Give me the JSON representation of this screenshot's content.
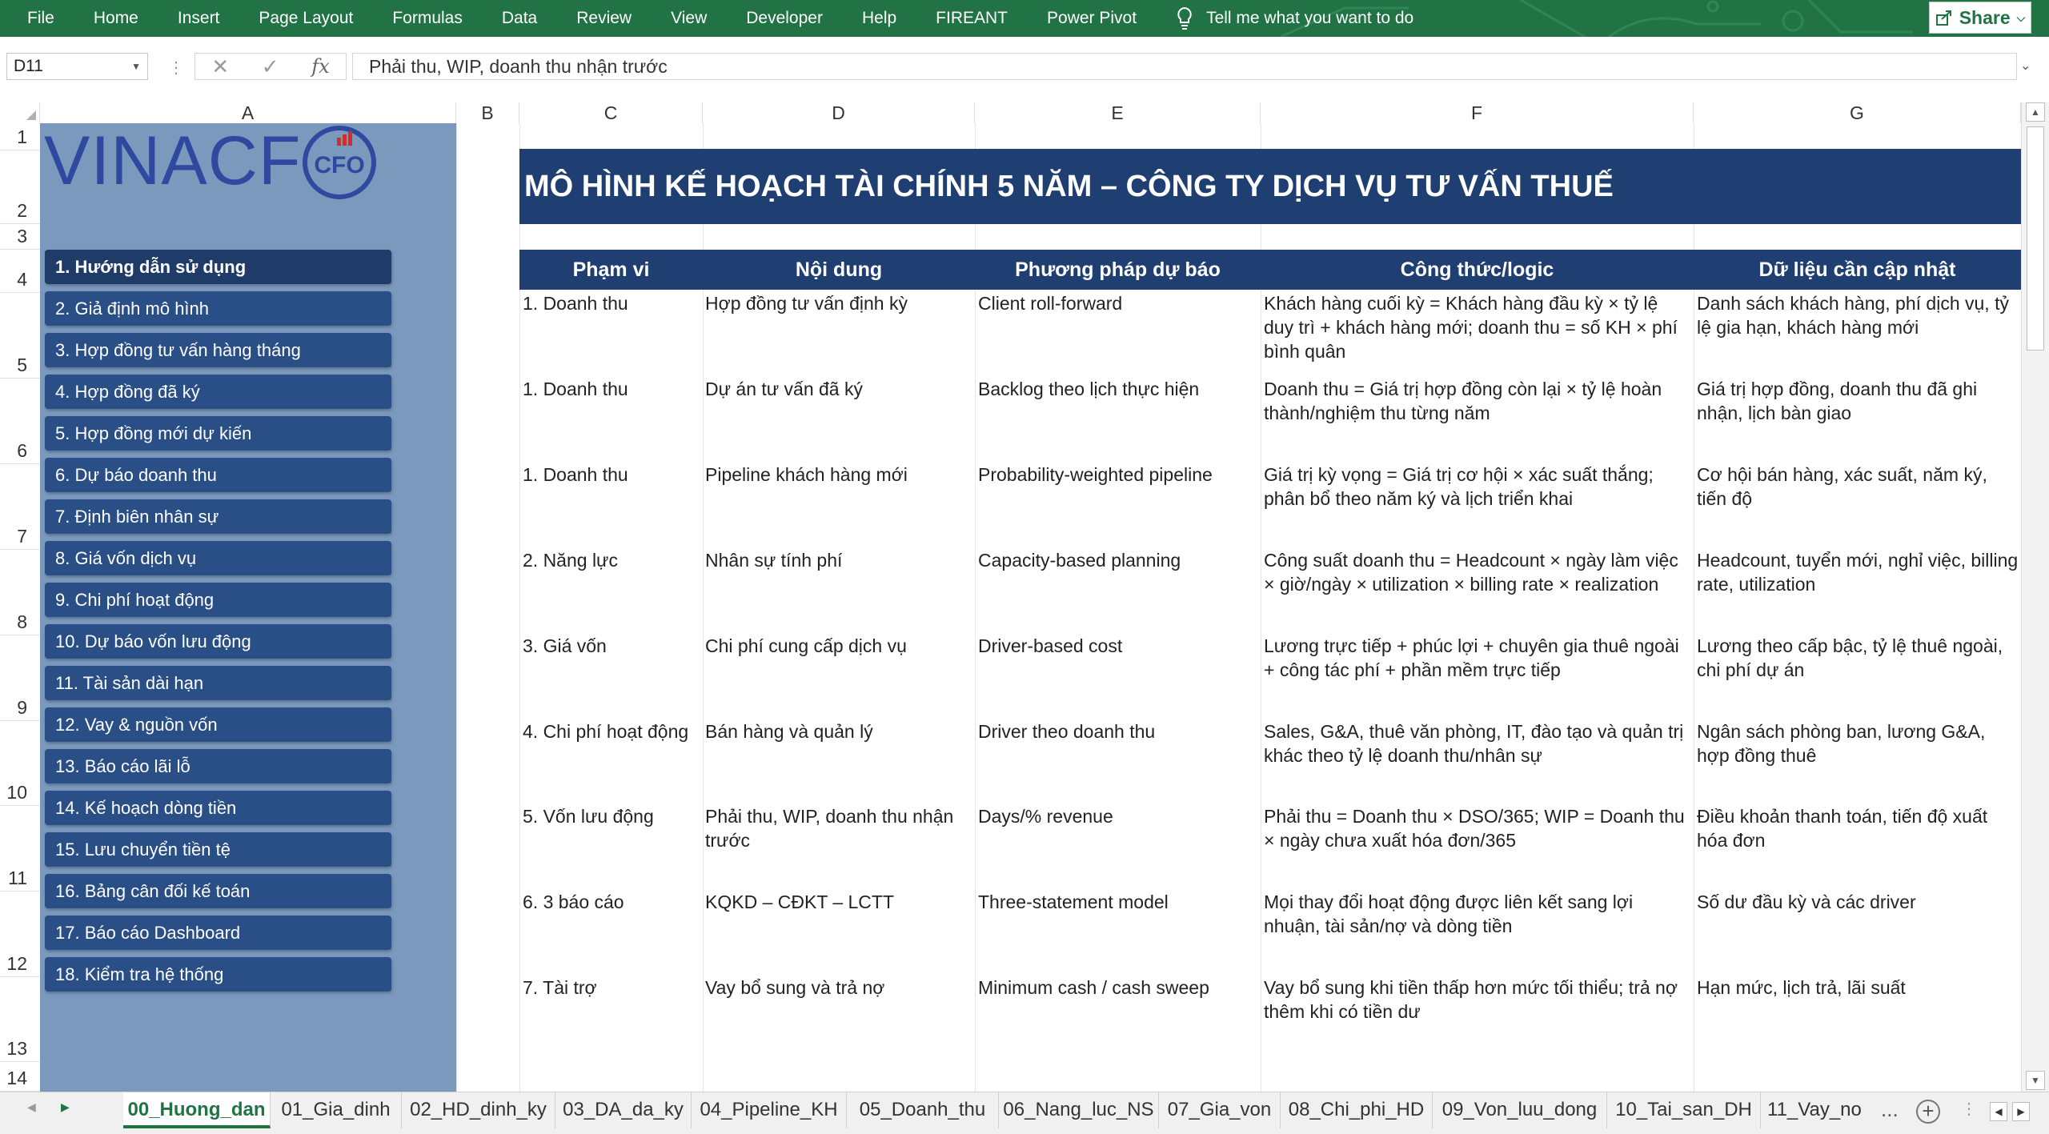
{
  "ribbon": {
    "menu": [
      "File",
      "Home",
      "Insert",
      "Page Layout",
      "Formulas",
      "Data",
      "Review",
      "View",
      "Developer",
      "Help",
      "FIREANT",
      "Power Pivot"
    ],
    "tell_me": "Tell me what you want to do",
    "share": "Share"
  },
  "formula_bar": {
    "name_box": "D11",
    "fx": "fx",
    "value": "Phải thu, WIP, doanh thu nhận trước"
  },
  "columns": [
    "A",
    "B",
    "C",
    "D",
    "E",
    "F",
    "G"
  ],
  "rows": [
    "1",
    "2",
    "3",
    "4",
    "5",
    "6",
    "7",
    "8",
    "9",
    "10",
    "11",
    "12",
    "13",
    "14"
  ],
  "logo": {
    "text": "VINACF",
    "badge": "CFO"
  },
  "nav": [
    "1. Hướng dẫn sử dụng",
    "2. Giả định mô hình",
    "3. Hợp đồng tư vấn hàng tháng",
    "4. Hợp đồng đã ký",
    "5. Hợp đồng mới dự kiến",
    "6. Dự báo doanh thu",
    "7. Định biên nhân sự",
    "8. Giá vốn dịch vụ",
    "9. Chi phí hoạt động",
    "10. Dự báo vốn lưu động",
    "11. Tài sản dài hạn",
    "12. Vay & nguồn vốn",
    "13. Báo cáo lãi lỗ",
    "14. Kế hoạch dòng tiền",
    "15. Lưu chuyển tiền tệ",
    "16. Bảng cân đối kế toán",
    "17. Báo cáo Dashboard",
    "18. Kiểm tra hệ thống"
  ],
  "title": "MÔ HÌNH KẾ HOẠCH TÀI CHÍNH 5 NĂM – CÔNG TY DỊCH VỤ TƯ VẤN THUẾ",
  "table": {
    "headers": [
      "Phạm vi",
      "Nội dung",
      "Phương pháp dự báo",
      "Công thức/logic",
      "Dữ liệu cần cập nhật"
    ],
    "rows": [
      [
        "1. Doanh thu",
        "Hợp đồng tư vấn định kỳ",
        "Client roll-forward",
        "Khách hàng cuối kỳ = Khách hàng đầu kỳ × tỷ lệ duy trì + khách hàng mới; doanh thu = số KH × phí bình quân",
        "Danh sách khách hàng, phí dịch vụ, tỷ lệ gia hạn, khách hàng mới"
      ],
      [
        "1. Doanh thu",
        "Dự án tư vấn đã ký",
        "Backlog theo lịch thực hiện",
        "Doanh thu = Giá trị hợp đồng còn lại × tỷ lệ hoàn thành/nghiệm thu từng năm",
        "Giá trị hợp đồng, doanh thu đã ghi nhận, lịch bàn giao"
      ],
      [
        "1. Doanh thu",
        "Pipeline khách hàng mới",
        "Probability-weighted pipeline",
        "Giá trị kỳ vọng = Giá trị cơ hội × xác suất thắng; phân bổ theo năm ký và lịch triển khai",
        "Cơ hội bán hàng, xác suất, năm ký, tiến độ"
      ],
      [
        "2. Năng lực",
        "Nhân sự tính phí",
        "Capacity-based planning",
        "Công suất doanh thu = Headcount × ngày làm việc × giờ/ngày × utilization × billing rate × realization",
        "Headcount, tuyển mới, nghỉ việc, billing rate, utilization"
      ],
      [
        "3. Giá vốn",
        "Chi phí cung cấp dịch vụ",
        "Driver-based cost",
        "Lương trực tiếp + phúc lợi + chuyên gia thuê ngoài + công tác phí + phần mềm trực tiếp",
        "Lương theo cấp bậc, tỷ lệ thuê ngoài, chi phí dự án"
      ],
      [
        "4. Chi phí hoạt động",
        "Bán hàng và quản lý",
        "Driver theo doanh thu",
        "Sales, G&A, thuê văn phòng, IT, đào tạo và quản trị khác theo tỷ lệ doanh thu/nhân sự",
        "Ngân sách phòng ban, lương G&A, hợp đồng thuê"
      ],
      [
        "5. Vốn lưu động",
        "Phải thu, WIP, doanh thu nhận trước",
        "Days/% revenue",
        "Phải thu = Doanh thu × DSO/365; WIP = Doanh thu × ngày chưa xuất hóa đơn/365",
        "Điều khoản thanh toán, tiến độ xuất hóa đơn"
      ],
      [
        "6. 3 báo cáo",
        "KQKD – CĐKT – LCTT",
        "Three-statement model",
        "Mọi thay đổi hoạt động được liên kết sang lợi nhuận, tài sản/nợ và dòng tiền",
        "Số dư đầu kỳ và các driver"
      ],
      [
        "7. Tài trợ",
        "Vay bổ sung và trả nợ",
        "Minimum cash / cash sweep",
        "Vay bổ sung khi tiền thấp hơn mức tối thiểu; trả nợ thêm khi có tiền dư",
        "Hạn mức, lịch trả, lãi suất"
      ]
    ]
  },
  "sheets": [
    "00_Huong_dan",
    "01_Gia_dinh",
    "02_HD_dinh_ky",
    "03_DA_da_ky",
    "04_Pipeline_KH",
    "05_Doanh_thu",
    "06_Nang_luc_NS",
    "07_Gia_von",
    "08_Chi_phi_HD",
    "09_Von_luu_dong",
    "10_Tai_san_DH",
    "11_Vay_no"
  ],
  "sheet_more": "...",
  "colors": {
    "ribbon": "#217346",
    "sidebar": "#7b99bd",
    "nav_button": "#2a4f86",
    "header_fill": "#1f3e72"
  }
}
